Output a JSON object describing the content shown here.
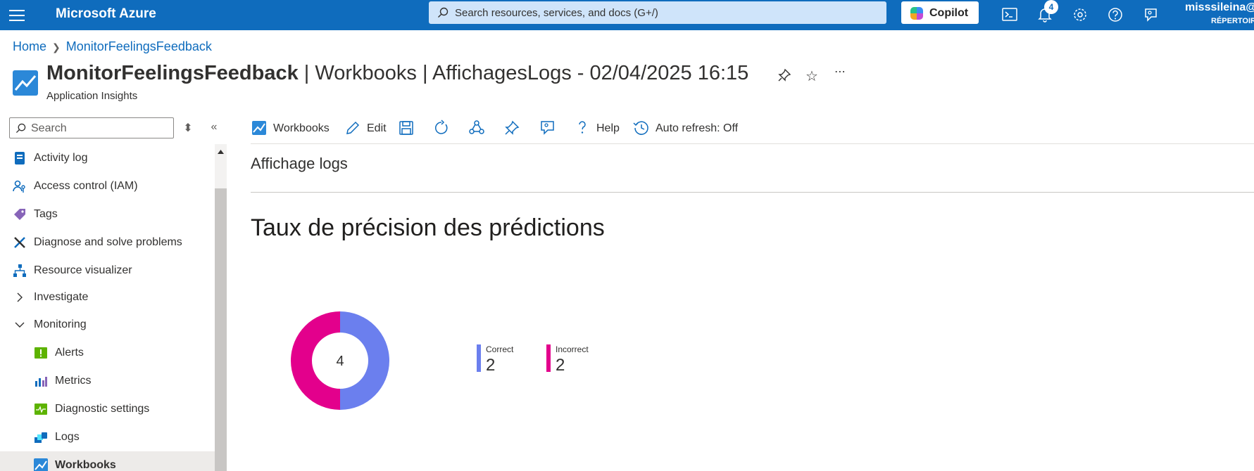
{
  "topbar": {
    "brand": "Microsoft Azure",
    "search_placeholder": "Search resources, services, and docs (G+/)",
    "copilot_label": "Copilot",
    "notifications_count": "4",
    "account_name": "misssileina@",
    "account_dir": "RÉPERTOIR"
  },
  "breadcrumb": {
    "items": [
      "Home",
      "MonitorFeelingsFeedback"
    ]
  },
  "header": {
    "resource_name": "MonitorFeelingsFeedback",
    "title_rest": " | Workbooks | AffichagesLogs - 02/04/2025 16:15",
    "subtitle": "Application Insights"
  },
  "nav": {
    "search_placeholder": "Search",
    "items": [
      {
        "label": "Activity log",
        "icon": "activity-log-icon"
      },
      {
        "label": "Access control (IAM)",
        "icon": "access-control-icon"
      },
      {
        "label": "Tags",
        "icon": "tag-icon"
      },
      {
        "label": "Diagnose and solve problems",
        "icon": "wrench-icon"
      },
      {
        "label": "Resource visualizer",
        "icon": "hierarchy-icon"
      },
      {
        "label": "Investigate",
        "icon": "chevron-right-icon"
      },
      {
        "label": "Monitoring",
        "icon": "chevron-down-icon"
      },
      {
        "label": "Alerts",
        "icon": "alert-icon"
      },
      {
        "label": "Metrics",
        "icon": "metrics-icon"
      },
      {
        "label": "Diagnostic settings",
        "icon": "diagnostic-settings-icon"
      },
      {
        "label": "Logs",
        "icon": "logs-icon"
      },
      {
        "label": "Workbooks",
        "icon": "workbooks-icon"
      }
    ],
    "active": "Workbooks"
  },
  "toolbar": {
    "workbooks": "Workbooks",
    "edit": "Edit",
    "help": "Help",
    "auto_refresh": "Auto refresh: Off"
  },
  "content": {
    "section_title": "Affichage logs",
    "chart_title": "Taux de précision des prédictions"
  },
  "colors": {
    "azure_blue": "#0f6cbd",
    "correct": "#6b7fee",
    "incorrect": "#e3008c"
  },
  "chart_data": {
    "type": "pie",
    "title": "Taux de précision des prédictions",
    "center_label": "4",
    "categories": [
      "Correct",
      "Incorrect"
    ],
    "values": [
      2,
      2
    ],
    "colors": [
      "#6b7fee",
      "#e3008c"
    ],
    "legend_position": "right"
  }
}
